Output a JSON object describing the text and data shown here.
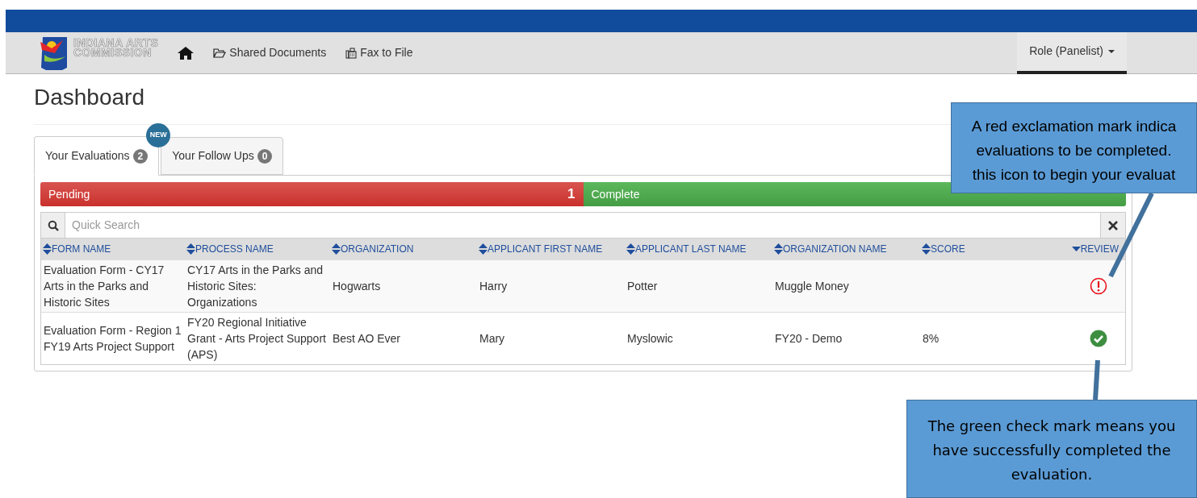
{
  "navbar": {
    "logo_text": [
      "INDIANA ARTS",
      "COMMISSION"
    ],
    "links": [
      {
        "label": "Shared Documents"
      },
      {
        "label": "Fax to File"
      }
    ],
    "role_menu": "Role (Panelist)"
  },
  "page_title": "Dashboard",
  "tabs": [
    {
      "label": "Your Evaluations",
      "count": "2",
      "new_badge": "NEW",
      "selected": true
    },
    {
      "label": "Your Follow Ups",
      "count": "0",
      "selected": false
    }
  ],
  "progress": {
    "segments": [
      {
        "label": "Pending",
        "count": "1",
        "kind": "pending",
        "level": 0.5
      },
      {
        "label": "Complete",
        "kind": "complete",
        "level": 0.5
      }
    ]
  },
  "search": {
    "placeholder": "Quick Search"
  },
  "table": {
    "columns": [
      {
        "label": "FORM NAME",
        "sorted": false
      },
      {
        "label": "PROCESS NAME",
        "sorted": false
      },
      {
        "label": "ORGANIZATION",
        "sorted": false
      },
      {
        "label": "APPLICANT FIRST NAME",
        "sorted": false
      },
      {
        "label": "APPLICANT LAST NAME",
        "sorted": false
      },
      {
        "label": "ORGANIZATION NAME",
        "sorted": false
      },
      {
        "label": "SCORE",
        "sorted": false
      },
      {
        "label": "REVIEW",
        "sorted": true
      }
    ],
    "rows": [
      {
        "cells": [
          "Evaluation Form - CY17 Arts in the Parks and Historic Sites",
          "CY17 Arts in the Parks and Historic Sites: Organizations",
          "Hogwarts",
          "Harry",
          "Potter",
          "Muggle Money",
          ""
        ],
        "completed": false
      },
      {
        "cells": [
          "Evaluation Form - Region 1 FY19 Arts Project Support",
          "FY20 Regional Initiative Grant - Arts Project Support (APS)",
          "Best AO Ever",
          "Mary",
          "Myslowic",
          "FY20 - Demo",
          "8%"
        ],
        "completed": true
      }
    ]
  },
  "callouts": [
    {
      "lines": [
        "A red exclamation mark indica",
        "evaluations to be completed.",
        "this icon to begin your evaluat"
      ],
      "kind": "top"
    },
    {
      "lines": [
        "The green check mark means you",
        "have successfully completed the",
        "evaluation."
      ],
      "kind": "bottom"
    }
  ]
}
